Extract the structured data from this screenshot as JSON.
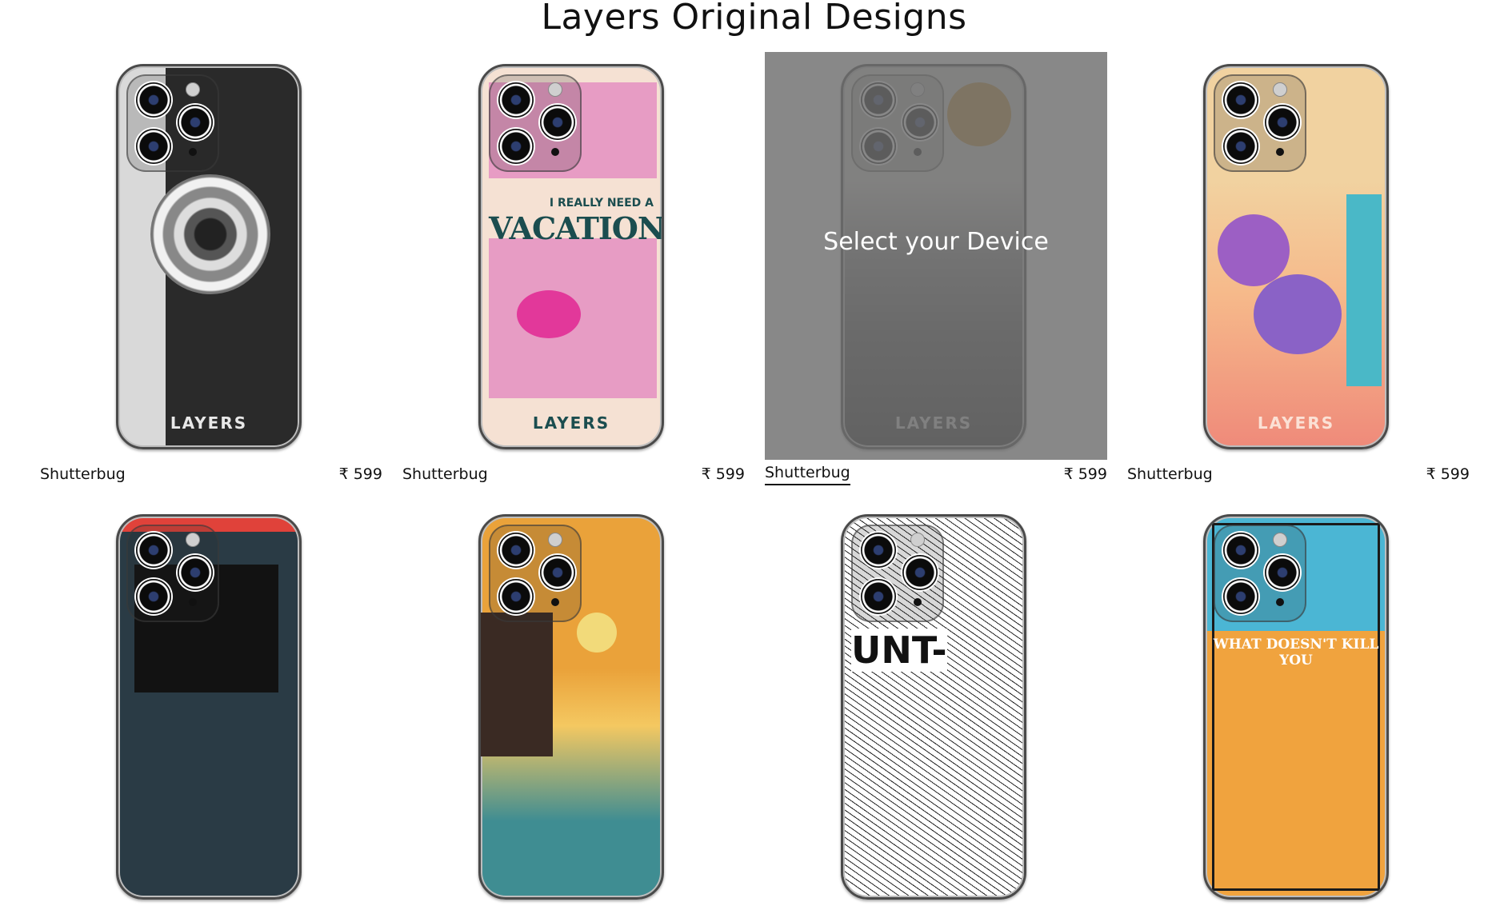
{
  "page_title": "Layers Original Designs",
  "brand": "LAYERS",
  "overlay_label": "Select your Device",
  "design_slogans": {
    "vacation_line1": "I REALLY NEED A",
    "vacation_line2": "VACATION",
    "unt": "UNT-",
    "kill": "WHAT DOESN'T KILL YOU"
  },
  "products": [
    {
      "name": "Shutterbug",
      "price": "₹ 599",
      "hover": false
    },
    {
      "name": "Shutterbug",
      "price": "₹ 599",
      "hover": false
    },
    {
      "name": "Shutterbug",
      "price": "₹ 599",
      "hover": true
    },
    {
      "name": "Shutterbug",
      "price": "₹ 599",
      "hover": false
    }
  ]
}
